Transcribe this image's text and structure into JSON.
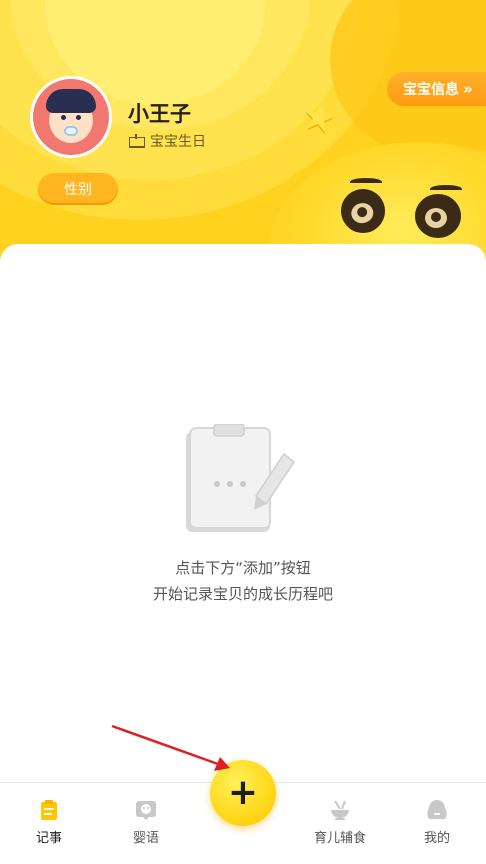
{
  "header": {
    "baby_name": "小王子",
    "birthday_label": "宝宝生日",
    "gender_button": "性别",
    "baby_info_button": "宝宝信息",
    "baby_info_chevron": "»"
  },
  "empty_state": {
    "line1": "点击下方“添加”按钮",
    "line2": "开始记录宝贝的成长历程吧"
  },
  "add_button": {
    "label": "+"
  },
  "tabbar": {
    "items": [
      {
        "label": "记事",
        "icon": "notes-icon",
        "active": true
      },
      {
        "label": "婴语",
        "icon": "baby-talk-icon",
        "active": false
      },
      {
        "label": "育儿辅食",
        "icon": "food-bowl-icon",
        "active": false
      },
      {
        "label": "我的",
        "icon": "profile-icon",
        "active": false
      }
    ]
  },
  "colors": {
    "header_yellow": "#ffd21f",
    "accent_orange": "#ff9a12",
    "add_button_yellow": "#ffd81a",
    "active_tab_icon": "#ffc600",
    "annotation_arrow": "#e02020"
  }
}
